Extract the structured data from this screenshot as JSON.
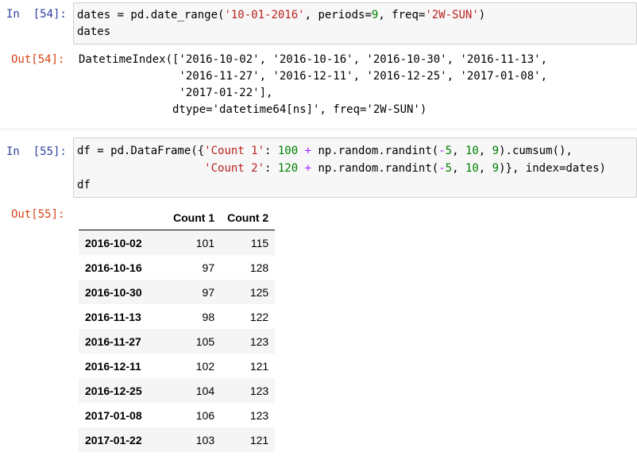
{
  "cells": [
    {
      "in_prompt": "In  [54]:",
      "out_prompt": "Out[54]:",
      "code": [
        [
          {
            "t": "dates = pd.date_range(",
            "c": ""
          },
          {
            "t": "'10-01-2016'",
            "c": "str"
          },
          {
            "t": ", periods=",
            "c": ""
          },
          {
            "t": "9",
            "c": "num"
          },
          {
            "t": ", freq=",
            "c": ""
          },
          {
            "t": "'2W-SUN'",
            "c": "str"
          },
          {
            "t": ")",
            "c": ""
          }
        ],
        [
          {
            "t": "dates",
            "c": ""
          }
        ]
      ],
      "output_lines": [
        "DatetimeIndex(['2016-10-02', '2016-10-16', '2016-10-30', '2016-11-13',",
        "               '2016-11-27', '2016-12-11', '2016-12-25', '2017-01-08',",
        "               '2017-01-22'],",
        "              dtype='datetime64[ns]', freq='2W-SUN')"
      ]
    },
    {
      "in_prompt": "In  [55]:",
      "out_prompt": "Out[55]:",
      "code": [
        [
          {
            "t": "df = pd.DataFrame({",
            "c": ""
          },
          {
            "t": "'Count 1'",
            "c": "str"
          },
          {
            "t": ": ",
            "c": ""
          },
          {
            "t": "100",
            "c": "num"
          },
          {
            "t": " ",
            "c": ""
          },
          {
            "t": "+",
            "c": "op"
          },
          {
            "t": " np.random.randint(",
            "c": ""
          },
          {
            "t": "-",
            "c": "op"
          },
          {
            "t": "5",
            "c": "num"
          },
          {
            "t": ", ",
            "c": ""
          },
          {
            "t": "10",
            "c": "num"
          },
          {
            "t": ", ",
            "c": ""
          },
          {
            "t": "9",
            "c": "num"
          },
          {
            "t": ").cumsum(),",
            "c": ""
          }
        ],
        [
          {
            "t": "                   ",
            "c": ""
          },
          {
            "t": "'Count 2'",
            "c": "str"
          },
          {
            "t": ": ",
            "c": ""
          },
          {
            "t": "120",
            "c": "num"
          },
          {
            "t": " ",
            "c": ""
          },
          {
            "t": "+",
            "c": "op"
          },
          {
            "t": " np.random.randint(",
            "c": ""
          },
          {
            "t": "-",
            "c": "op"
          },
          {
            "t": "5",
            "c": "num"
          },
          {
            "t": ", ",
            "c": ""
          },
          {
            "t": "10",
            "c": "num"
          },
          {
            "t": ", ",
            "c": ""
          },
          {
            "t": "9",
            "c": "num"
          },
          {
            "t": ")}, index=dates)",
            "c": ""
          }
        ],
        [
          {
            "t": "df",
            "c": ""
          }
        ]
      ],
      "table": {
        "columns": [
          "",
          "Count 1",
          "Count 2"
        ],
        "rows": [
          [
            "2016-10-02",
            "101",
            "115"
          ],
          [
            "2016-10-16",
            "97",
            "128"
          ],
          [
            "2016-10-30",
            "97",
            "125"
          ],
          [
            "2016-11-13",
            "98",
            "122"
          ],
          [
            "2016-11-27",
            "105",
            "123"
          ],
          [
            "2016-12-11",
            "102",
            "121"
          ],
          [
            "2016-12-25",
            "104",
            "123"
          ],
          [
            "2017-01-08",
            "106",
            "123"
          ],
          [
            "2017-01-22",
            "103",
            "121"
          ]
        ]
      }
    }
  ],
  "colors": {
    "in_prompt": "#303F9F",
    "out_prompt": "#D84315",
    "string": "#BA2121",
    "number": "#008000",
    "operator": "#AA22FF",
    "input_bg": "#f7f7f7"
  }
}
